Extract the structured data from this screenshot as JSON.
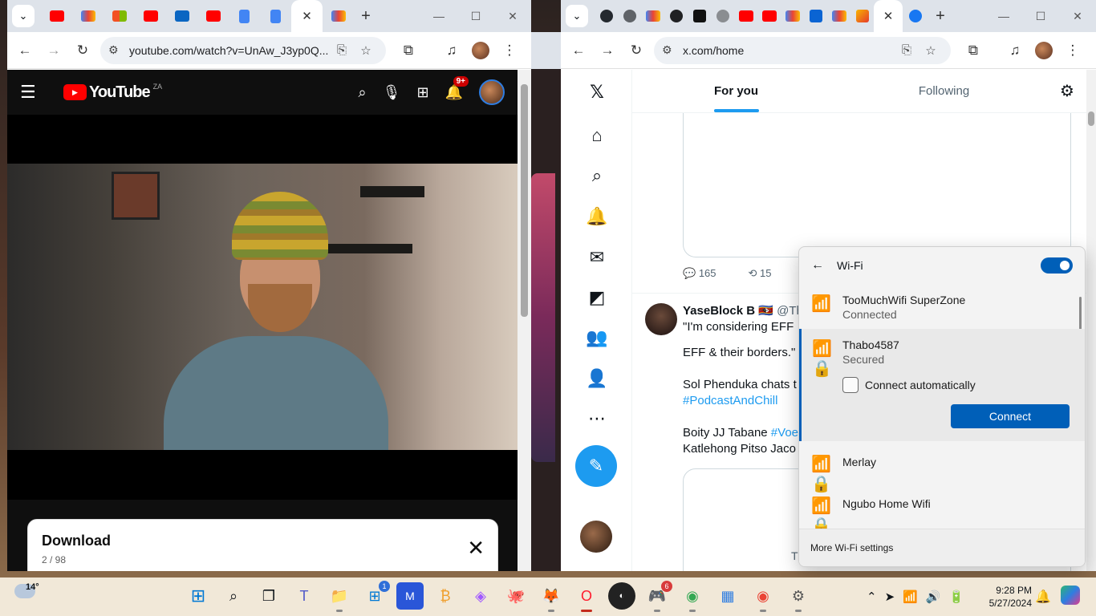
{
  "left_browser": {
    "tabs": [
      {
        "icon": "youtube-icon",
        "color": "#ff0000"
      },
      {
        "icon": "gmail-icon",
        "color": "#ea4335"
      },
      {
        "icon": "microsoft-icon",
        "color": "#f25022"
      },
      {
        "icon": "youtube-icon",
        "color": "#ff0000"
      },
      {
        "icon": "linkedin-icon",
        "color": "#0a66c2"
      },
      {
        "icon": "youtube-icon",
        "color": "#ff0000"
      },
      {
        "icon": "docs-icon",
        "color": "#4285f4"
      },
      {
        "icon": "docs-icon",
        "color": "#4285f4"
      },
      {
        "icon": "close-icon",
        "active": true
      },
      {
        "icon": "gmail-icon",
        "color": "#ea4335"
      }
    ],
    "url": "youtube.com/watch?v=UnAw_J3yp0Q..."
  },
  "youtube": {
    "logo_text": "YouTube",
    "country_code": "ZA",
    "notification_badge": "9+",
    "card_title": "Download",
    "card_count": "2 / 98"
  },
  "right_browser": {
    "url": "x.com/home"
  },
  "x": {
    "tabs": [
      "For you",
      "Following"
    ],
    "actions": {
      "replies": "165",
      "reposts": "15"
    },
    "post": {
      "name": "YaseBlock B",
      "handle": "@Th",
      "line1": "\"I'm considering EFF",
      "line2": "EFF & their borders.\"",
      "line3": "Sol Phenduka chats t",
      "hashtag1": "#PodcastAndChill",
      "line4_prefix": "Boity JJ Tabane ",
      "hashtag2": "#Voe",
      "line5": "Katlehong Pitso Jaco"
    },
    "quote_fragment": "T"
  },
  "wifi": {
    "title": "Wi-Fi",
    "enabled": true,
    "networks": [
      {
        "name": "TooMuchWifi SuperZone",
        "status": "Connected",
        "secured": false
      },
      {
        "name": "Thabo4587",
        "status": "Secured",
        "secured": true,
        "expanded": true
      },
      {
        "name": "Merlay",
        "status": "",
        "secured": true
      },
      {
        "name": "Ngubo Home Wifi",
        "status": "",
        "secured": true
      }
    ],
    "connect_auto_label": "Connect automatically",
    "connect_button": "Connect",
    "more_settings": "More Wi-Fi settings"
  },
  "taskbar": {
    "weather_temp": "14°",
    "time": "9:28 PM",
    "date": "5/27/2024",
    "store_badge": "1",
    "discord_badge": "6",
    "accent": "#005fb8"
  }
}
